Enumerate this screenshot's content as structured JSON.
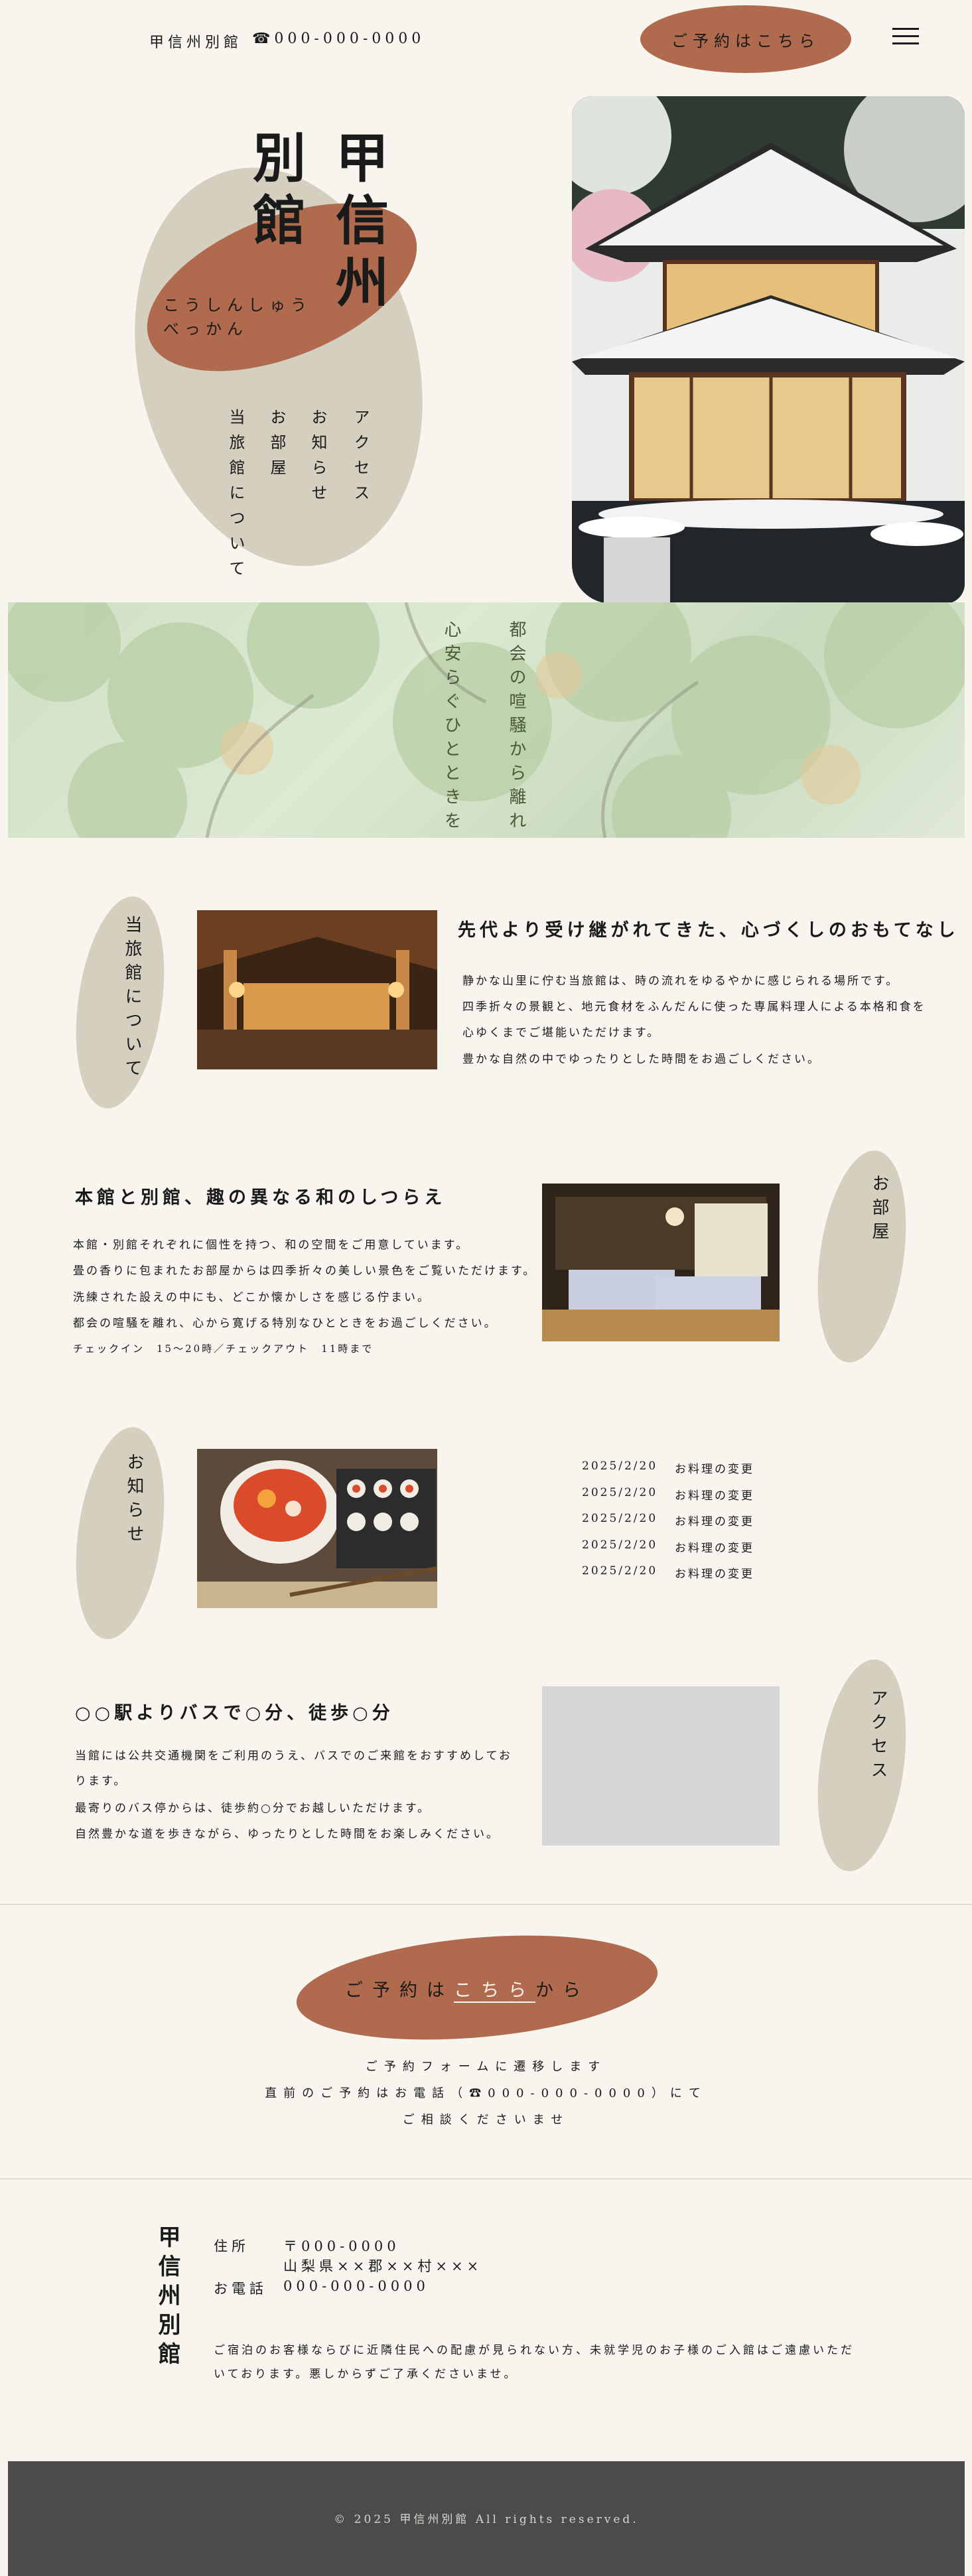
{
  "header": {
    "site_name": "甲信州別館",
    "tel": "☎000-000-0000",
    "reserve_button": "ご予約はこちら"
  },
  "hero": {
    "title_col_1": "甲信州",
    "title_col_2": "別館",
    "kana_line_1": "こうしんしゅう",
    "kana_line_2": "べっかん",
    "nav": [
      "アクセス",
      "お知らせ",
      "お部屋",
      "当旅館について"
    ]
  },
  "banner": {
    "line_1": "都会の喧騒から離れ",
    "line_2": "心安らぐひとときを"
  },
  "about": {
    "label": "当旅館について",
    "title": "先代より受け継がれてきた、心づくしのおもてなし",
    "lines": [
      "静かな山里に佇む当旅館は、時の流れをゆるやかに感じられる場所です。",
      "四季折々の景観と、地元食材をふんだんに使った専属料理人による本格和食を",
      "心ゆくまでご堪能いただけます。",
      "豊かな自然の中でゆったりとした時間をお過ごしください。"
    ]
  },
  "rooms": {
    "label": "お部屋",
    "title": "本館と別館、趣の異なる和のしつらえ",
    "lines": [
      "本館・別館それぞれに個性を持つ、和の空間をご用意しています。",
      "畳の香りに包まれたお部屋からは四季折々の美しい景色をご覧いただけます。",
      "洗練された設えの中にも、どこか懐かしさを感じる佇まい。",
      "都会の喧騒を離れ、心から寛げる特別なひとときをお過ごしください。",
      "チェックイン　15～20時／チェックアウト　11時まで"
    ]
  },
  "news": {
    "label": "お知らせ",
    "items": [
      {
        "date": "2025/2/20",
        "text": "お料理の変更"
      },
      {
        "date": "2025/2/20",
        "text": "お料理の変更"
      },
      {
        "date": "2025/2/20",
        "text": "お料理の変更"
      },
      {
        "date": "2025/2/20",
        "text": "お料理の変更"
      },
      {
        "date": "2025/2/20",
        "text": "お料理の変更"
      }
    ]
  },
  "access": {
    "label": "アクセス",
    "title": "○○駅よりバスで○分、徒歩○分",
    "lines": [
      "当館には公共交通機関をご利用のうえ、バスでのご来館をおすすめしてお",
      "ります。",
      "最寄りのバス停からは、徒歩約○分でお越しいただけます。",
      "自然豊かな道を歩きながら、ゆったりとした時間をお楽しみください。"
    ]
  },
  "cta": {
    "prefix": "ご予約は",
    "link": "こちら",
    "suffix": "から",
    "line_1": "ご予約フォームに遷移します",
    "line_2": "直前のご予約はお電話（☎000-000-0000）にて",
    "line_3": "ご相談くださいませ"
  },
  "footer": {
    "logo": "甲信州別館",
    "address_label": "住所",
    "postal": "〒000-0000",
    "address": "山梨県××郡××村×××",
    "tel_label": "お電話",
    "tel": "000-000-0000",
    "note": "ご宿泊のお客様ならびに近隣住民への配慮が見られない方、未就学児のお子様のご入館はご遠慮いただいております。悪しからずご了承くださいませ。",
    "copyright": "© 2025 甲信州別館 All rights reserved."
  },
  "colors": {
    "background": "#f8f5ef",
    "accent": "#b06a4d",
    "blob": "#d5cfbf",
    "footer": "#4b4b4b"
  }
}
